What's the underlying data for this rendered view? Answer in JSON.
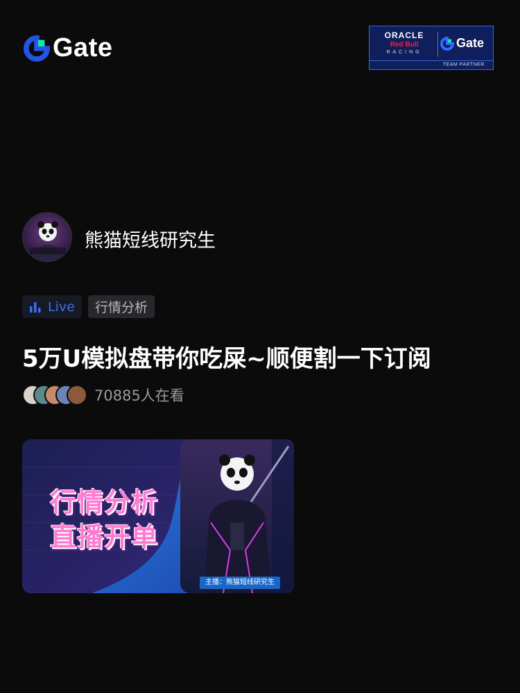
{
  "header": {
    "logo_text": "Gate",
    "partner": {
      "oracle": "ORACLE",
      "redbull": "Red Bull",
      "racing": "RACING",
      "gate_text": "Gate",
      "footer": "TEAM PARTNER"
    }
  },
  "host": {
    "name": "熊猫短线研究生",
    "avatar_label": "熊猫短线研究生"
  },
  "tags": {
    "live": "Live",
    "category": "行情分析"
  },
  "stream": {
    "title": "5万U模拟盘带你吃屎~顺便割一下订阅",
    "viewer_count": "70885人在看"
  },
  "thumbnail": {
    "line1": "行情分析",
    "line2": "直播开单",
    "caption": "主播：熊猫短线研究生"
  },
  "colors": {
    "brand_blue": "#2354e6",
    "brand_green": "#17e6a1",
    "live_blue": "#3d6cf0",
    "background": "#0b0b0c"
  }
}
